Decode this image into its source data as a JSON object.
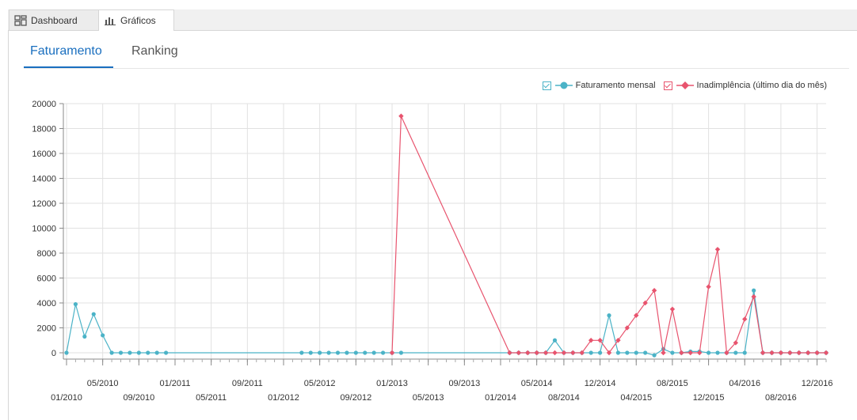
{
  "tabs": [
    {
      "label": "Dashboard",
      "icon": "dashboard-icon"
    },
    {
      "label": "Gráficos",
      "icon": "bar-chart-icon"
    }
  ],
  "subtabs": [
    {
      "label": "Faturamento"
    },
    {
      "label": "Ranking"
    }
  ],
  "legend": [
    {
      "label": "Faturamento mensal",
      "color": "#4bb3c7"
    },
    {
      "label": "Inadimplência (último dia do mês)",
      "color": "#e8546e"
    }
  ],
  "chart_data": {
    "type": "line",
    "xlabel": "",
    "ylabel": "",
    "ylim": [
      0,
      20000
    ],
    "y_ticks": [
      0,
      2000,
      4000,
      6000,
      8000,
      10000,
      12000,
      14000,
      16000,
      18000,
      20000
    ],
    "x_range": [
      "2010-01",
      "2016-12"
    ],
    "x_ticks": [
      "01/2010",
      "05/2010",
      "09/2010",
      "01/2011",
      "05/2011",
      "09/2011",
      "01/2012",
      "05/2012",
      "09/2012",
      "01/2013",
      "05/2013",
      "09/2013",
      "01/2014",
      "05/2014",
      "08/2014",
      "12/2014",
      "04/2015",
      "08/2015",
      "12/2015",
      "04/2016",
      "08/2016",
      "12/2016"
    ],
    "grid": true,
    "legend_position": "top-right",
    "series": [
      {
        "name": "Faturamento mensal",
        "color": "#4bb3c7",
        "points": [
          [
            "2010-01",
            0
          ],
          [
            "2010-02",
            3900
          ],
          [
            "2010-03",
            1300
          ],
          [
            "2010-04",
            3100
          ],
          [
            "2010-05",
            1400
          ],
          [
            "2010-06",
            0
          ],
          [
            "2010-07",
            0
          ],
          [
            "2010-08",
            0
          ],
          [
            "2010-09",
            0
          ],
          [
            "2010-10",
            0
          ],
          [
            "2010-11",
            0
          ],
          [
            "2010-12",
            0
          ],
          [
            "2012-03",
            0
          ],
          [
            "2012-04",
            0
          ],
          [
            "2012-05",
            0
          ],
          [
            "2012-06",
            0
          ],
          [
            "2012-07",
            0
          ],
          [
            "2012-08",
            0
          ],
          [
            "2012-09",
            0
          ],
          [
            "2012-10",
            0
          ],
          [
            "2012-11",
            0
          ],
          [
            "2012-12",
            0
          ],
          [
            "2013-01",
            0
          ],
          [
            "2013-02",
            0
          ],
          [
            "2014-02",
            0
          ],
          [
            "2014-03",
            0
          ],
          [
            "2014-04",
            0
          ],
          [
            "2014-05",
            0
          ],
          [
            "2014-06",
            0
          ],
          [
            "2014-07",
            1000
          ],
          [
            "2014-08",
            0
          ],
          [
            "2014-09",
            0
          ],
          [
            "2014-10",
            0
          ],
          [
            "2014-11",
            0
          ],
          [
            "2014-12",
            0
          ],
          [
            "2015-01",
            3000
          ],
          [
            "2015-02",
            0
          ],
          [
            "2015-03",
            0
          ],
          [
            "2015-04",
            0
          ],
          [
            "2015-05",
            0
          ],
          [
            "2015-06",
            -200
          ],
          [
            "2015-07",
            300
          ],
          [
            "2015-08",
            0
          ],
          [
            "2015-09",
            0
          ],
          [
            "2015-10",
            100
          ],
          [
            "2015-11",
            100
          ],
          [
            "2015-12",
            0
          ],
          [
            "2016-01",
            0
          ],
          [
            "2016-02",
            0
          ],
          [
            "2016-03",
            0
          ],
          [
            "2016-04",
            0
          ],
          [
            "2016-05",
            5000
          ],
          [
            "2016-06",
            0
          ],
          [
            "2016-07",
            0
          ],
          [
            "2016-08",
            0
          ],
          [
            "2016-09",
            0
          ],
          [
            "2016-10",
            0
          ],
          [
            "2016-11",
            0
          ],
          [
            "2016-12",
            0
          ],
          [
            "2017-01",
            0
          ]
        ]
      },
      {
        "name": "Inadimplência (último dia do mês)",
        "color": "#e8546e",
        "points": [
          [
            "2013-01",
            0
          ],
          [
            "2013-02",
            19000
          ],
          [
            "2014-02",
            0
          ],
          [
            "2014-03",
            0
          ],
          [
            "2014-04",
            0
          ],
          [
            "2014-05",
            0
          ],
          [
            "2014-06",
            0
          ],
          [
            "2014-07",
            0
          ],
          [
            "2014-08",
            0
          ],
          [
            "2014-09",
            0
          ],
          [
            "2014-10",
            0
          ],
          [
            "2014-11",
            1000
          ],
          [
            "2014-12",
            1000
          ],
          [
            "2015-01",
            0
          ],
          [
            "2015-02",
            1000
          ],
          [
            "2015-03",
            2000
          ],
          [
            "2015-04",
            3000
          ],
          [
            "2015-05",
            4000
          ],
          [
            "2015-06",
            5000
          ],
          [
            "2015-07",
            0
          ],
          [
            "2015-08",
            3500
          ],
          [
            "2015-09",
            0
          ],
          [
            "2015-10",
            0
          ],
          [
            "2015-11",
            0
          ],
          [
            "2015-12",
            5300
          ],
          [
            "2016-01",
            8300
          ],
          [
            "2016-02",
            0
          ],
          [
            "2016-03",
            800
          ],
          [
            "2016-04",
            2700
          ],
          [
            "2016-05",
            4500
          ],
          [
            "2016-06",
            0
          ],
          [
            "2016-07",
            0
          ],
          [
            "2016-08",
            0
          ],
          [
            "2016-09",
            0
          ],
          [
            "2016-10",
            0
          ],
          [
            "2016-11",
            0
          ],
          [
            "2016-12",
            0
          ],
          [
            "2017-01",
            0
          ]
        ]
      }
    ]
  }
}
